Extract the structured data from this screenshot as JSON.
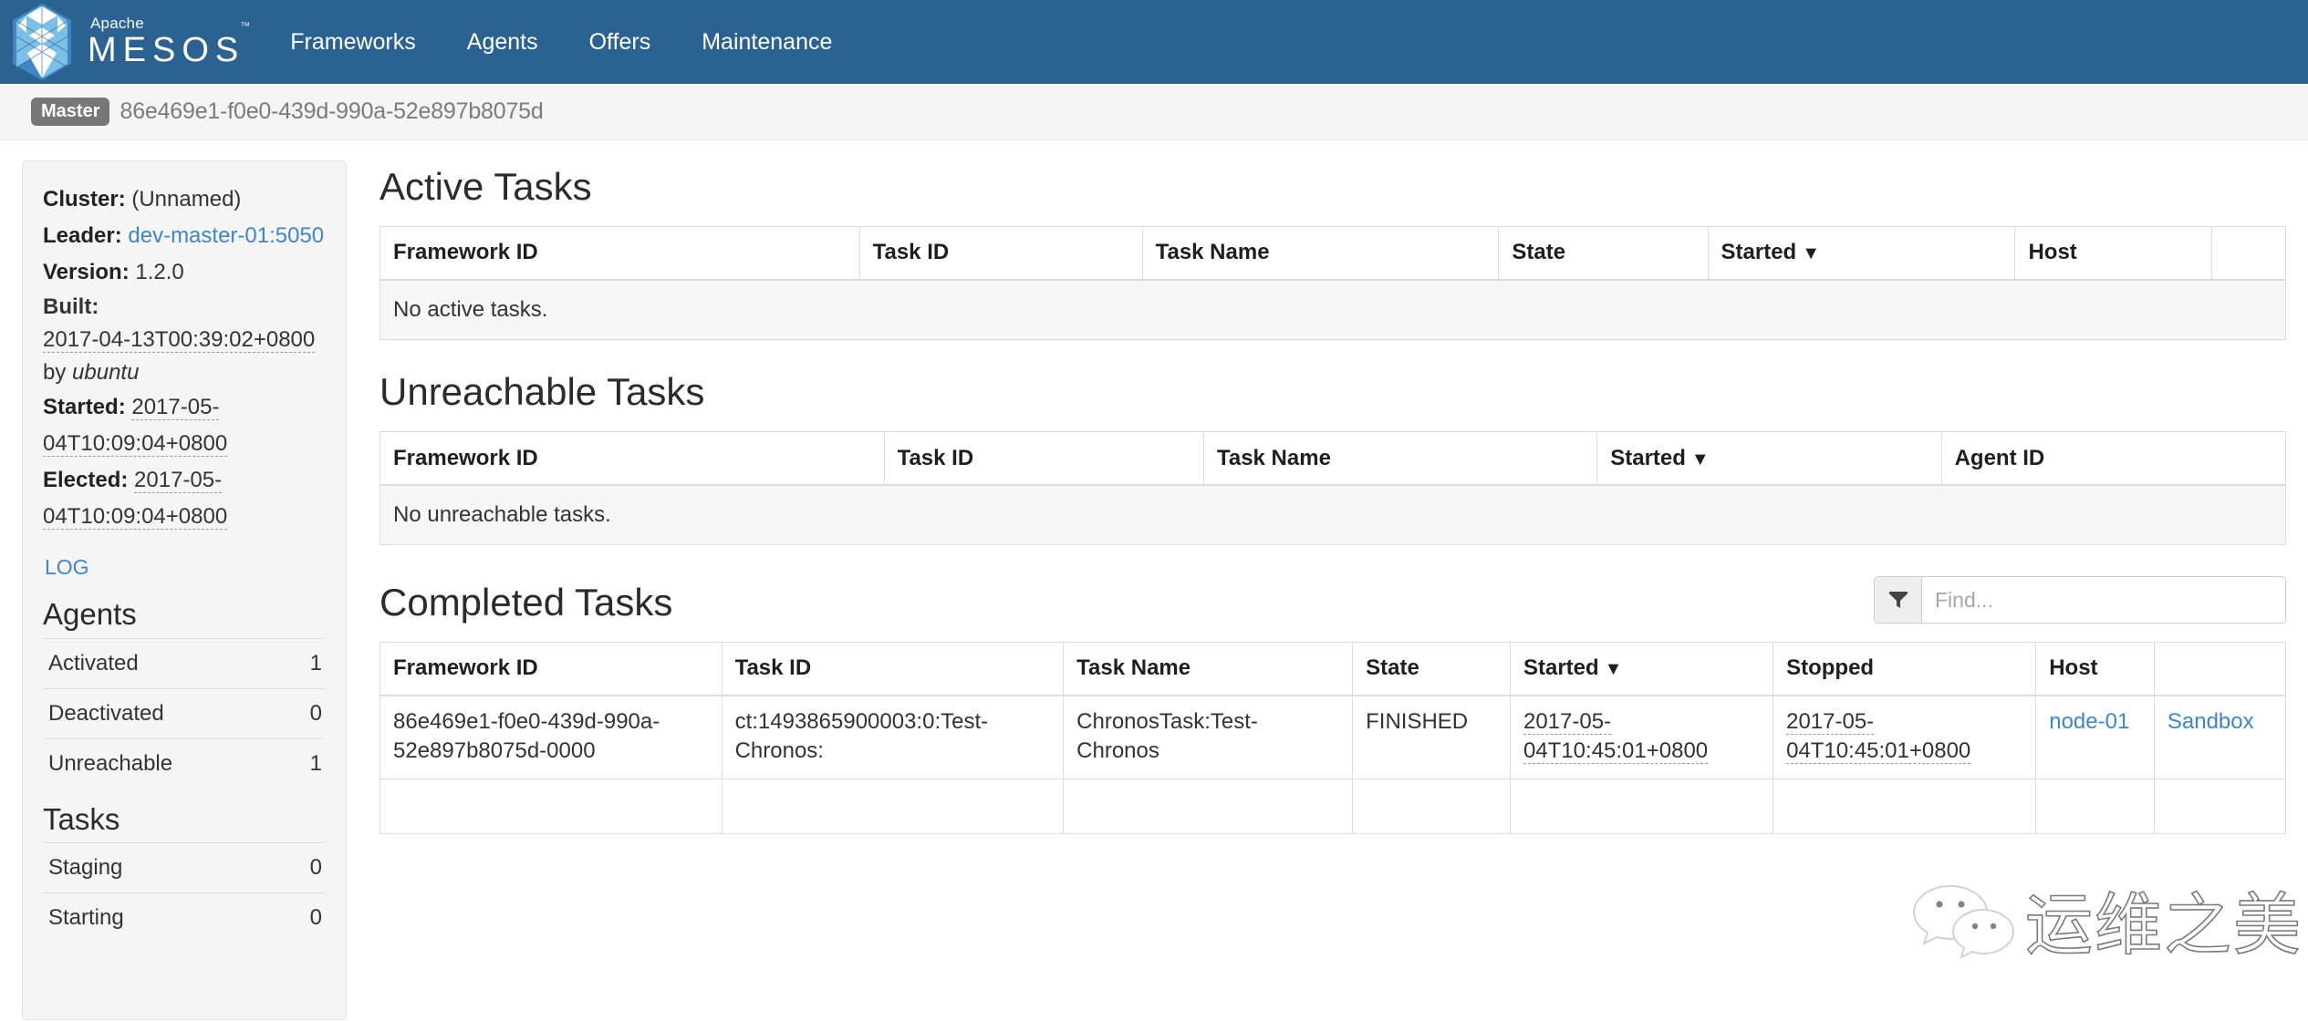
{
  "navbar": {
    "brand_apache": "Apache",
    "brand_name": "MESOS",
    "brand_tm": "™",
    "logo_icon": "mesos-hex-logo-icon",
    "links": [
      {
        "label": "Frameworks"
      },
      {
        "label": "Agents"
      },
      {
        "label": "Offers"
      },
      {
        "label": "Maintenance"
      }
    ],
    "background_color": "#2b6292"
  },
  "masterbar": {
    "badge_label": "Master",
    "master_id": "86e469e1-f0e0-439d-990a-52e897b8075d"
  },
  "sidebar": {
    "cluster_label": "Cluster:",
    "cluster_value": "(Unnamed)",
    "leader_label": "Leader:",
    "leader_value": "dev-master-01:5050",
    "version_label": "Version:",
    "version_value": "1.2.0",
    "built_label": "Built:",
    "built_time": "2017-04-13T00:39:02+0800",
    "built_by_word": "by",
    "built_by_user": "ubuntu",
    "started_label": "Started:",
    "started_value": "2017-05-04T10:09:04+0800",
    "elected_label": "Elected:",
    "elected_value": "2017-05-04T10:09:04+0800",
    "log_link": "LOG",
    "agents": {
      "heading": "Agents",
      "rows": [
        {
          "label": "Activated",
          "value": "1"
        },
        {
          "label": "Deactivated",
          "value": "0"
        },
        {
          "label": "Unreachable",
          "value": "1"
        }
      ]
    },
    "tasks": {
      "heading": "Tasks",
      "rows": [
        {
          "label": "Staging",
          "value": "0"
        },
        {
          "label": "Starting",
          "value": "0"
        }
      ]
    }
  },
  "main": {
    "active_tasks": {
      "title": "Active Tasks",
      "columns": [
        "Framework ID",
        "Task ID",
        "Task Name",
        "State",
        "Started",
        "Host",
        ""
      ],
      "sort_column": "Started",
      "sort_caret": "▼",
      "empty_message": "No active tasks.",
      "rows": []
    },
    "unreachable_tasks": {
      "title": "Unreachable Tasks",
      "columns": [
        "Framework ID",
        "Task ID",
        "Task Name",
        "Started",
        "Agent ID"
      ],
      "sort_column": "Started",
      "sort_caret": "▼",
      "empty_message": "No unreachable tasks.",
      "rows": []
    },
    "completed_tasks": {
      "title": "Completed Tasks",
      "filter_icon": "filter-funnel-icon",
      "find_placeholder": "Find...",
      "find_value": "",
      "columns": [
        "Framework ID",
        "Task ID",
        "Task Name",
        "State",
        "Started",
        "Stopped",
        "Host",
        ""
      ],
      "sort_column": "Started",
      "sort_caret": "▼",
      "rows": [
        {
          "framework_id": "86e469e1-f0e0-439d-990a-52e897b8075d-0000",
          "task_id": "ct:1493865900003:0:Test-Chronos:",
          "task_name": "ChronosTask:Test-Chronos",
          "state": "FINISHED",
          "started": "2017-05-04T10:45:01+0800",
          "stopped": "2017-05-04T10:45:01+0800",
          "host": "node-01",
          "sandbox_label": "Sandbox"
        }
      ]
    }
  },
  "watermark": {
    "icon": "wechat-icon",
    "text": "运维之美"
  },
  "colors": {
    "navbar": "#2b6292",
    "link": "#3f86c8",
    "badge": "#777777",
    "panel": "#f5f5f5"
  }
}
